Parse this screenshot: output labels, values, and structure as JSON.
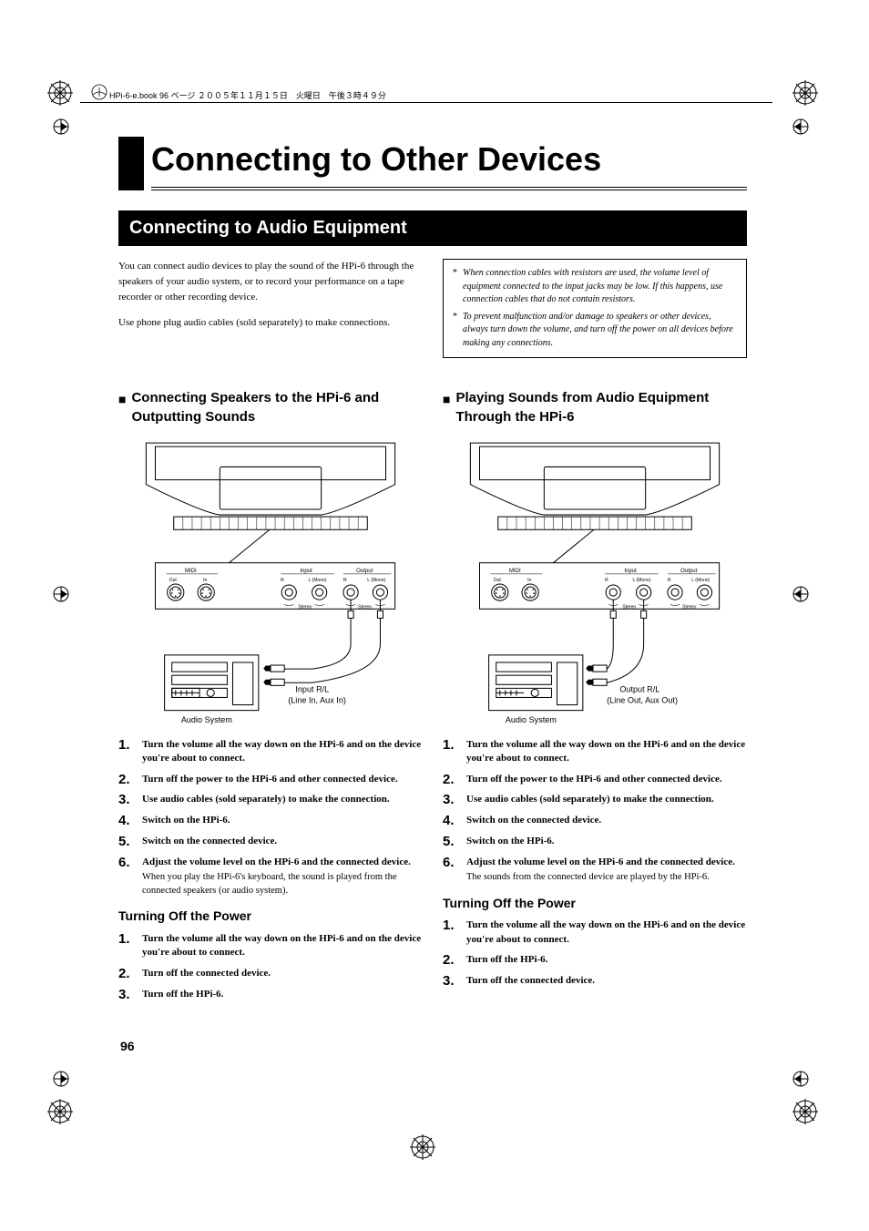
{
  "running_header": "HPi-6-e.book 96 ページ ２００５年１１月１５日　火曜日　午後３時４９分",
  "chapter_title": "Connecting to Other Devices",
  "section_title": "Connecting to Audio Equipment",
  "intro_col1": [
    "You can connect audio devices to play the sound of the HPi-6 through the speakers of your audio system, or to record your performance on a tape recorder or other recording device.",
    "Use phone plug audio cables (sold separately) to make connections."
  ],
  "notes": [
    "When connection cables with resistors are used, the volume level of equipment connected to the input jacks may be low. If this happens, use connection cables that do not contain resistors.",
    "To prevent malfunction and/or damage to speakers or other devices, always turn down the volume, and turn off the power on all devices before making any connections."
  ],
  "left": {
    "subhead": "Connecting Speakers to the HPi-6 and Outputting Sounds",
    "diagram": {
      "midi_label": "MIDI",
      "midi_out": "Out",
      "midi_in": "In",
      "input_label": "Input",
      "output_label": "Output",
      "r_label": "R",
      "l_mono_label": "L (Mono)",
      "stereo_label": "Stereo",
      "jack_label_line1": "Input R/L",
      "jack_label_line2": "(Line In, Aux In)",
      "audio_system": "Audio System"
    },
    "steps": [
      {
        "t": "Turn the volume all the way down on the HPi-6 and on the device you're about to connect."
      },
      {
        "t": "Turn off the power to the HPi-6 and other connected device."
      },
      {
        "t": "Use audio cables (sold separately) to make the connection."
      },
      {
        "t": "Switch on the HPi-6."
      },
      {
        "t": "Switch on the connected device."
      },
      {
        "t": "Adjust the volume level on the HPi-6 and the connected device.",
        "n": "When you play the HPi-6's keyboard, the sound is played from the connected speakers (or audio system)."
      }
    ],
    "turning_off_title": "Turning Off the Power",
    "off_steps": [
      "Turn the volume all the way down on the HPi-6 and on the device you're about to connect.",
      "Turn off the connected device.",
      "Turn off the HPi-6."
    ]
  },
  "right": {
    "subhead": "Playing Sounds from Audio Equipment Through the HPi-6",
    "diagram": {
      "midi_label": "MIDI",
      "midi_out": "Out",
      "midi_in": "In",
      "input_label": "Input",
      "output_label": "Output",
      "r_label": "R",
      "l_mono_label": "L (Mono)",
      "stereo_label": "Stereo",
      "jack_label_line1": "Output R/L",
      "jack_label_line2": "(Line Out, Aux Out)",
      "audio_system": "Audio System"
    },
    "steps": [
      {
        "t": "Turn the volume all the way down on the HPi-6 and on the device you're about to connect."
      },
      {
        "t": "Turn off the power to the HPi-6 and other connected device."
      },
      {
        "t": "Use audio cables (sold separately) to make the connection."
      },
      {
        "t": "Switch on the connected device."
      },
      {
        "t": "Switch on the HPi-6."
      },
      {
        "t": "Adjust the volume level on the HPi-6 and the connected device.",
        "n": "The sounds from the connected device are played by the HPi-6."
      }
    ],
    "turning_off_title": "Turning Off the Power",
    "off_steps": [
      "Turn the volume all the way down on the HPi-6 and on the device you're about to connect.",
      "Turn off the HPi-6.",
      "Turn off the connected device."
    ]
  },
  "page_number": "96"
}
